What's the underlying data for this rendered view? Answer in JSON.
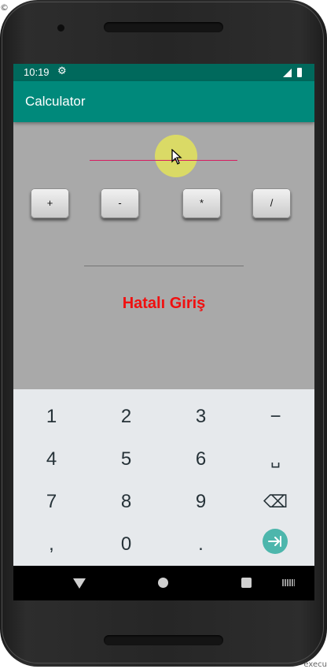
{
  "status_bar": {
    "time": "10:19",
    "settings_icon": "gear-icon"
  },
  "app_bar": {
    "title": "Calculator"
  },
  "operations": [
    {
      "label": "+"
    },
    {
      "label": "-"
    },
    {
      "label": "*"
    },
    {
      "label": "/"
    }
  ],
  "result": {
    "text": "Hatalı Giriş",
    "color": "#f01010"
  },
  "keyboard": {
    "rows": [
      [
        "1",
        "2",
        "3",
        "−"
      ],
      [
        "4",
        "5",
        "6",
        "␣"
      ],
      [
        "7",
        "8",
        "9",
        "⌫"
      ],
      [
        ",",
        "0",
        ".",
        "⇥"
      ]
    ]
  },
  "colors": {
    "status_bar": "#00695c",
    "app_bar": "#00897b",
    "accent": "#d81b60",
    "content_bg": "#a9a9a9",
    "keyboard_bg": "#e6e9ec",
    "enter_key": "#4db6ac"
  },
  "nav_bar": {
    "icons": [
      "back-icon",
      "home-icon",
      "recent-apps-icon",
      "keyboard-icon"
    ]
  },
  "frame": {
    "corner_text": "execu"
  }
}
